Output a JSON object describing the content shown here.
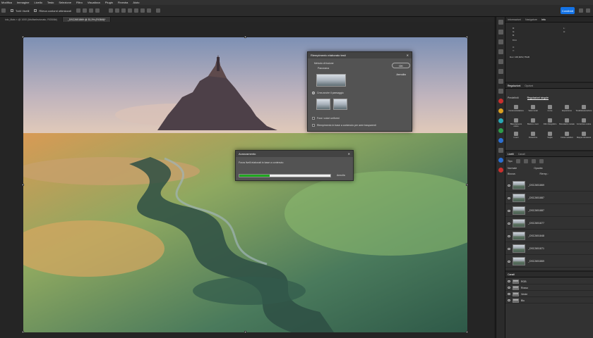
{
  "menu": [
    "Modifica",
    "Immagine",
    "Livello",
    "Testo",
    "Selezione",
    "Filtro",
    "Visualizza",
    "Plugin",
    "Finestra",
    "Aiuto"
  ],
  "options": {
    "sample_label": "Tutti i livelli",
    "auto_enhance_label": "Rileva contorni ottimizzati",
    "share_label": "Condividi"
  },
  "tabs": [
    "ioio_Mais × @ 1000 (Multiselezionato, RGB/8#)",
    "_DSC2651869 @ 33,3% (RGB/8)*"
  ],
  "fill_dialog": {
    "title": "Riempimento elaborato testi",
    "section": "Metodo di fusione",
    "opt1": "Panorama",
    "opt2": "Crea anche il paesaggio",
    "opt3": "Fora i colori uniformi",
    "opt4": "Riempimento in base a contenuto per aree trasparenti",
    "ok": "OK",
    "cancel": "Annulla"
  },
  "progress": {
    "title": "Avanzamento",
    "message": "Forza livelli elaborati in base a contenuto",
    "value": 0.33,
    "cancel": "Annulla"
  },
  "panels": {
    "top_tabs": [
      "Informazioni",
      "Navigatore",
      "Info"
    ],
    "info_lines": [
      "R:",
      "G:",
      "B:",
      "8 bit",
      "X:",
      "Y:",
      "L:",
      "A:",
      "Doc: 168,0M/2,75GB"
    ],
    "adj_tabs": [
      "Regolazioni",
      "Opzioni"
    ],
    "adj_subtabs": [
      "Predefiniti",
      "Regolazioni singole"
    ],
    "adjustments": [
      "Contenuto/elabora",
      "Valori tonali",
      "Curve",
      "Esposizione",
      "Tonalità/saturazione",
      "Bilanciamento colore",
      "Bianco e nero",
      "Filtro fotografico",
      "Miscelatore canale",
      "Correzione colore",
      "Inverti",
      "Posterizza",
      "Soglia",
      "Colore selettivo",
      "Mappa sfumatura"
    ],
    "layers_tabs": [
      "Livelli",
      "Canali"
    ],
    "layers_filters": [
      "Tipo",
      "Normale",
      "Opacità:",
      "Blocca:",
      "Riemp.:"
    ],
    "layers": [
      "_DSC2651869",
      "_DSC2651887",
      "_DSC2651887",
      "_DSC2651877",
      "_DSC2651848",
      "_DSC2651871",
      "_DSC2651869"
    ],
    "channels_title": "Canali",
    "channels": [
      "RGB",
      "Rosso",
      "Verde",
      "Blu"
    ]
  }
}
